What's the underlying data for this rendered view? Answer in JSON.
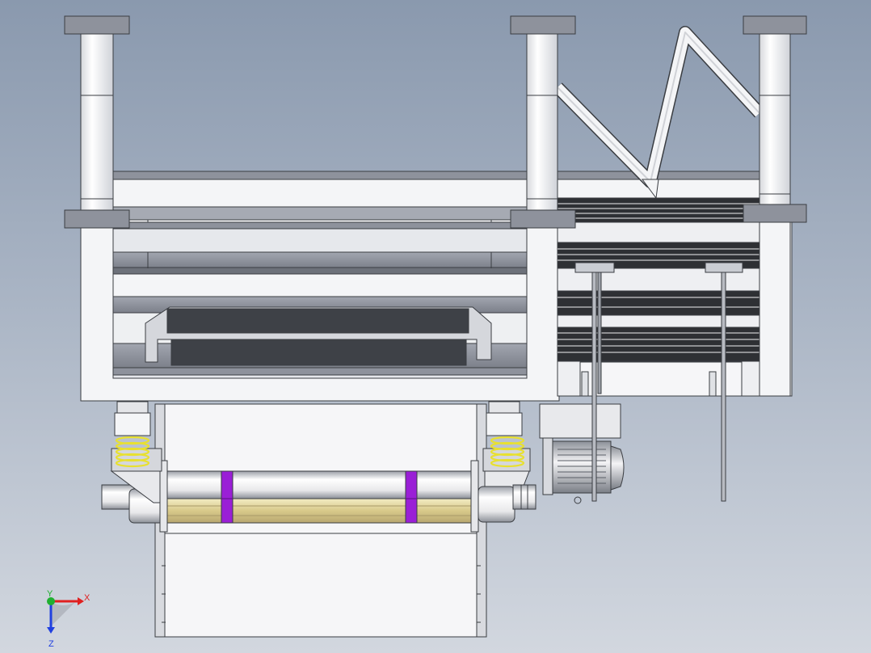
{
  "viewport": {
    "background_top": "#8a99ae",
    "background_bottom": "#d2d7df"
  },
  "colors": {
    "part": "#f2f3f5",
    "part_edge": "#3a3d42",
    "plate": "#8e929c",
    "dark": "#3e4147",
    "spring": "#e8e030",
    "band": "#9a1fd6",
    "belt": "#d9cc8a",
    "roller": "#e4e4e4"
  },
  "triad": {
    "x_label": "X",
    "y_label": "Y",
    "z_label": "Z",
    "x_color": "#e02020",
    "y_color": "#20b030",
    "z_color": "#2040e0"
  }
}
